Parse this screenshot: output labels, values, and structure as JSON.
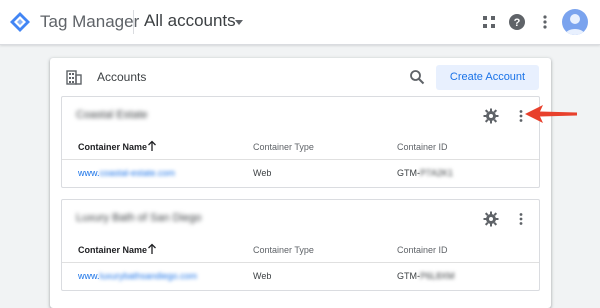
{
  "header": {
    "product_name": "Tag Manager",
    "account_switcher_label": "All accounts",
    "icons": [
      "apps-icon",
      "help-icon",
      "more-vert-icon",
      "avatar"
    ]
  },
  "accounts_card": {
    "title": "Accounts",
    "create_button": "Create Account",
    "accounts": [
      {
        "name": "Coastal Estate",
        "columns": {
          "name": "Container Name",
          "type": "Container Type",
          "id": "Container ID"
        },
        "row": {
          "name_prefix": "www.",
          "name_blurred": "coastal-estate.com",
          "type": "Web",
          "id_prefix": "GTM-",
          "id_blurred": "P7A2K1"
        }
      },
      {
        "name": "Luxury Bath of San Diego",
        "columns": {
          "name": "Container Name",
          "type": "Container Type",
          "id": "Container ID"
        },
        "row": {
          "name_prefix": "www.",
          "name_blurred": "luxurybathsandiego.com",
          "type": "Web",
          "id_prefix": "GTM-",
          "id_blurred": "P6L8XM"
        }
      }
    ]
  },
  "colors": {
    "accent": "#1a73e8",
    "arrow": "#e8402c",
    "button_bg": "#e8f0fe"
  }
}
